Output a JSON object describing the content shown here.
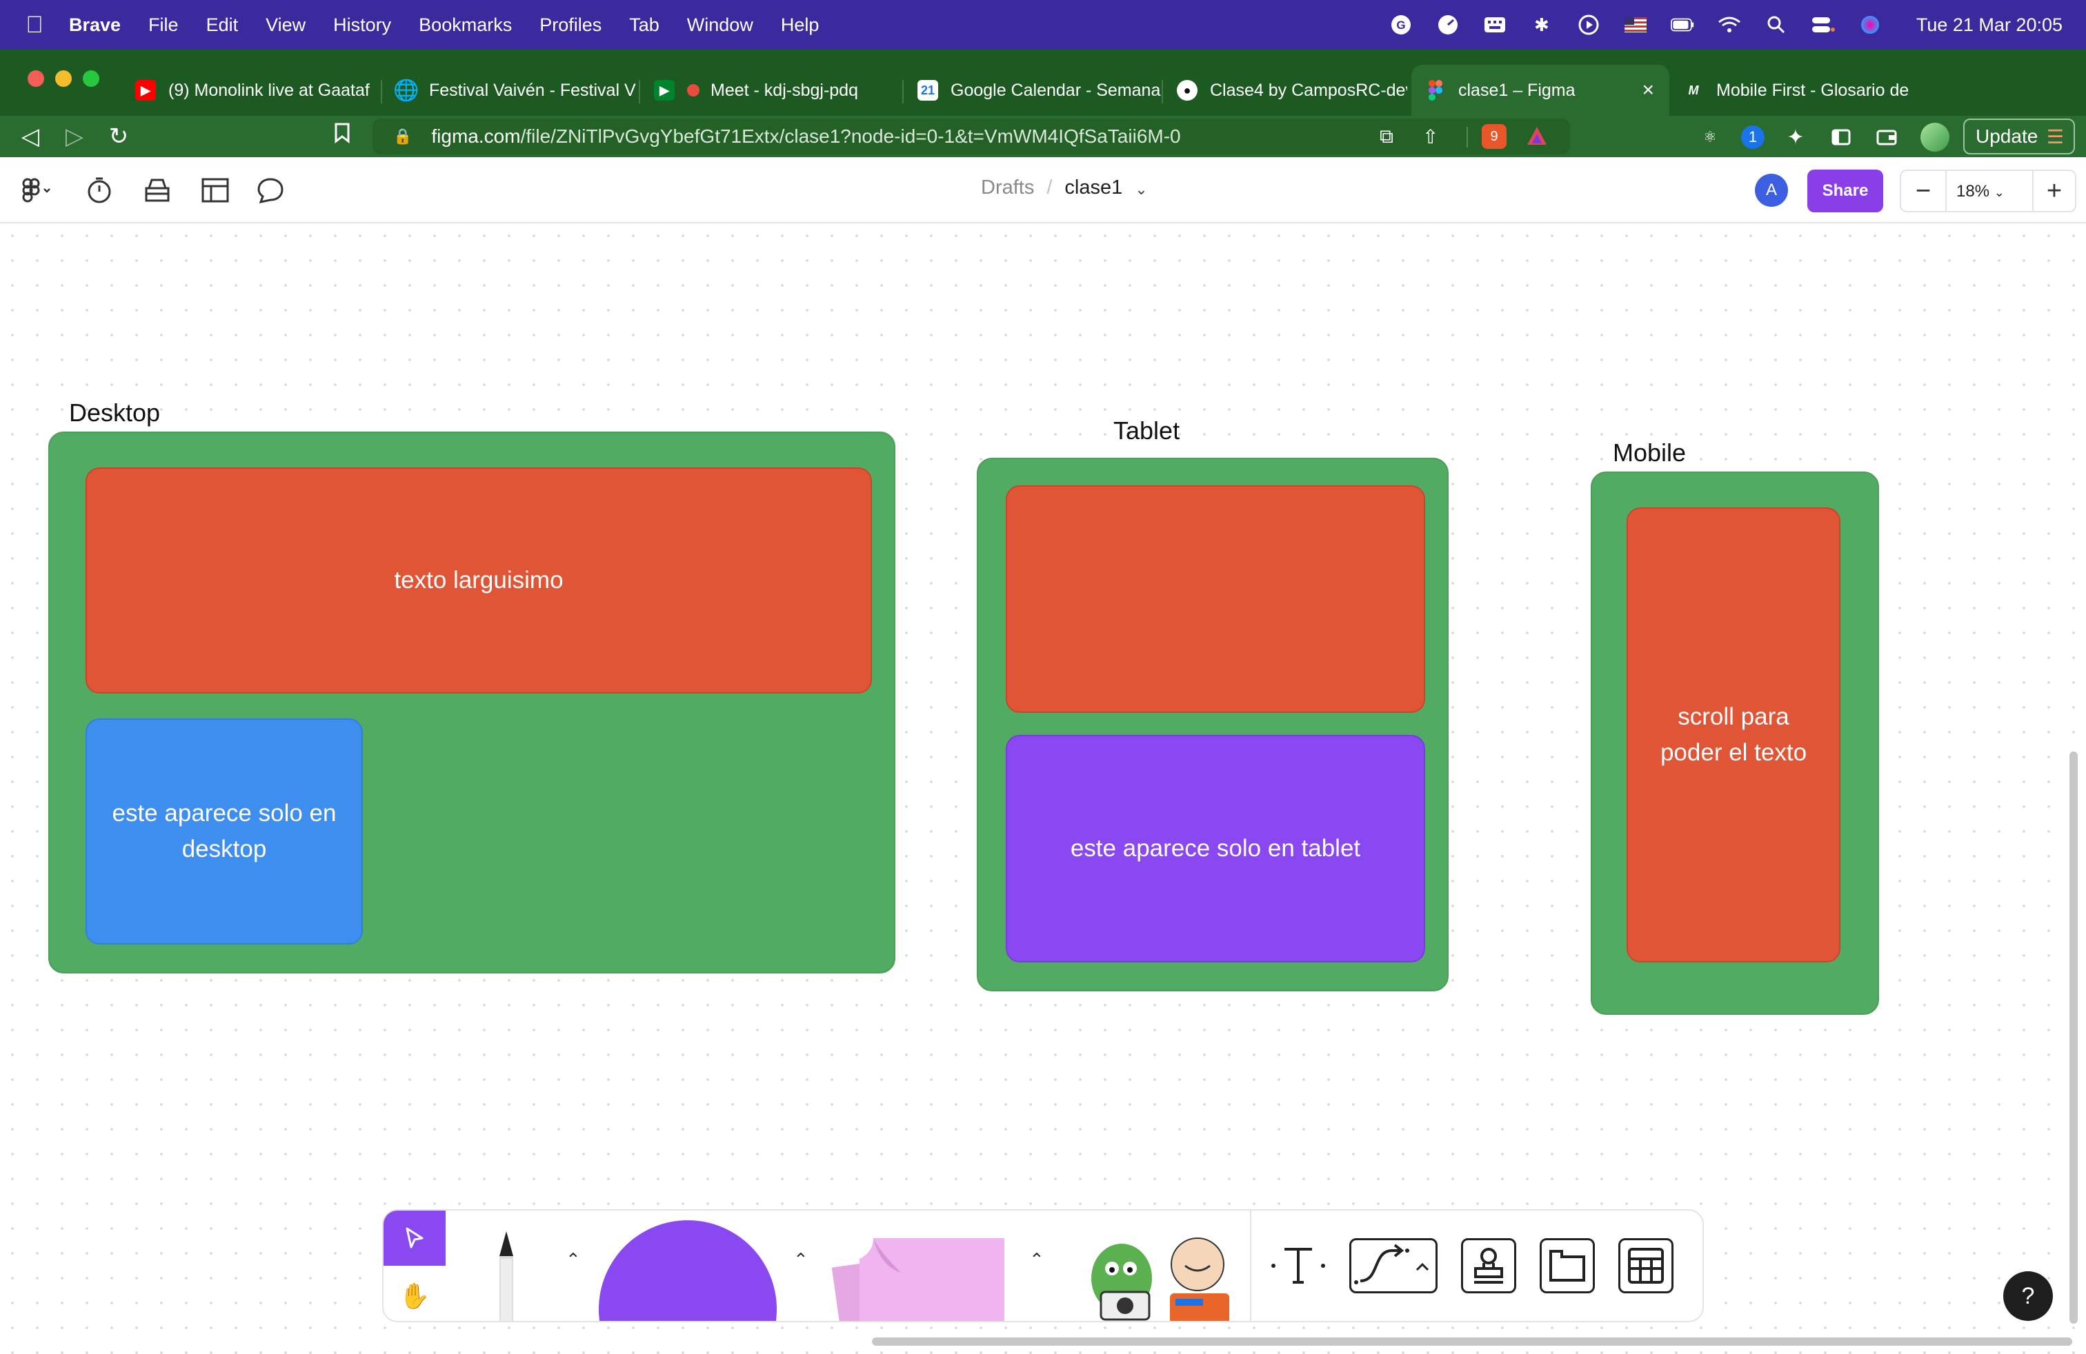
{
  "menubar": {
    "app": "Brave",
    "items": [
      "File",
      "Edit",
      "View",
      "History",
      "Bookmarks",
      "Profiles",
      "Tab",
      "Window",
      "Help"
    ],
    "clock": "Tue 21 Mar  20:05"
  },
  "tabs": [
    {
      "title": "(9) Monolink live at Gaataf",
      "favicon": "youtube-icon"
    },
    {
      "title": "Festival Vaivén - Festival V",
      "favicon": "globe-icon"
    },
    {
      "title": "Meet - kdj-sbgj-pdq",
      "favicon": "meet-icon"
    },
    {
      "title": "Google Calendar - Semana",
      "favicon": "calendar-icon"
    },
    {
      "title": "Clase4 by CamposRC-dev",
      "favicon": "github-icon"
    },
    {
      "title": "clase1 – Figma",
      "favicon": "figma-icon",
      "active": true
    },
    {
      "title": "Mobile First - Glosario de",
      "favicon": "glossary-icon"
    }
  ],
  "address": {
    "host": "figma.com",
    "path": "/file/ZNiTlPvGvgYbefGt71Extx/clase1?node-id=0-1&t=VmWM4IQfSaTaii6M-0",
    "brave_badge": "9",
    "update_label": "Update"
  },
  "figma": {
    "breadcrumb_drafts": "Drafts",
    "breadcrumb_sep": "/",
    "file_name": "clase1",
    "avatar_initial": "A",
    "share_label": "Share",
    "zoom": "18%"
  },
  "canvas": {
    "desktop": {
      "title": "Desktop",
      "card_red_text": "texto larguisimo",
      "card_blue_text": "este aparece solo en desktop"
    },
    "tablet": {
      "title": "Tablet",
      "card_purple_text": "este aparece solo en tablet"
    },
    "mobile": {
      "title": "Mobile",
      "card_red_text": "scroll para poder el texto"
    }
  },
  "colors": {
    "frame_green": "#52ab62",
    "card_red": "#e05535",
    "card_blue": "#3e8ef0",
    "card_purple": "#8a48f0",
    "figma_accent": "#8a48f0"
  },
  "help_label": "?"
}
